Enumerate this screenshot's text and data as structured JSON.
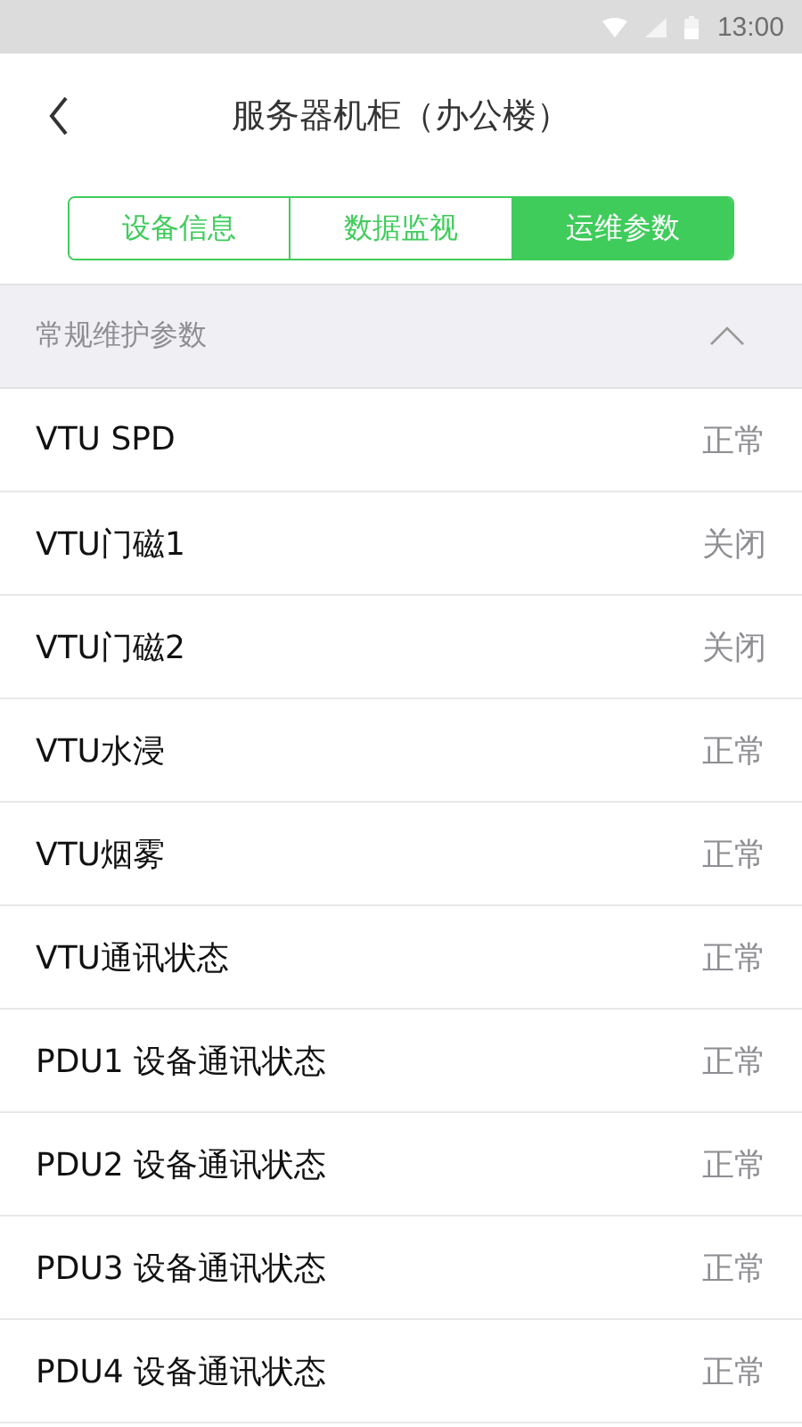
{
  "status_bar": {
    "time": "13:00"
  },
  "header": {
    "title": "服务器机柜（办公楼）"
  },
  "tabs": [
    {
      "label": "设备信息",
      "selected": false
    },
    {
      "label": "数据监视",
      "selected": false
    },
    {
      "label": "运维参数",
      "selected": true
    }
  ],
  "section": {
    "title": "常规维护参数",
    "expanded": true,
    "rows": [
      {
        "name": "VTU SPD",
        "value": "正常"
      },
      {
        "name": "VTU门磁1",
        "value": "关闭"
      },
      {
        "name": "VTU门磁2",
        "value": "关闭"
      },
      {
        "name": "VTU水浸",
        "value": "正常"
      },
      {
        "name": "VTU烟雾",
        "value": "正常"
      },
      {
        "name": "VTU通讯状态",
        "value": "正常"
      },
      {
        "name": "PDU1 设备通讯状态",
        "value": "正常"
      },
      {
        "name": "PDU2 设备通讯状态",
        "value": "正常"
      },
      {
        "name": "PDU3 设备通讯状态",
        "value": "正常"
      },
      {
        "name": "PDU4 设备通讯状态",
        "value": "正常"
      }
    ]
  }
}
